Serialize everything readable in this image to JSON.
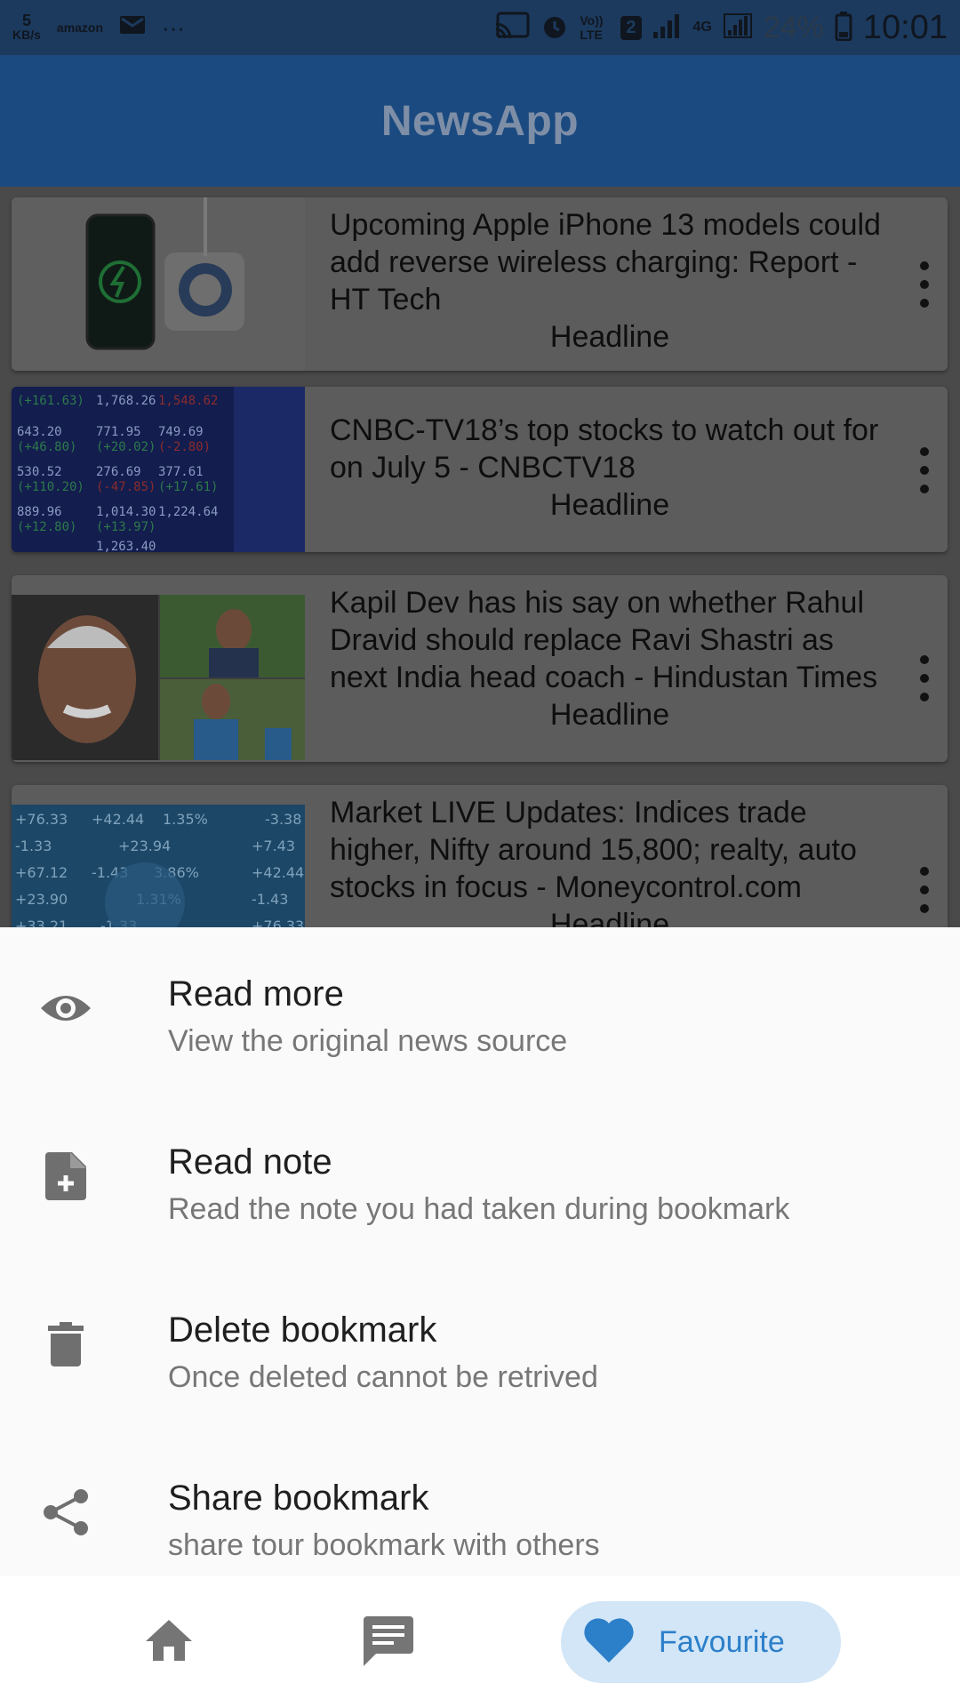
{
  "status_bar": {
    "net_speed_value": "5",
    "net_speed_unit": "KB/s",
    "notification_labels": [
      "amazon"
    ],
    "overflow": "···",
    "volte_label": "Vo)) LTE",
    "sim_badge": "2",
    "network_type": "4G",
    "battery_percent": "24%",
    "time": "10:01"
  },
  "app_bar": {
    "title": "NewsApp"
  },
  "articles": [
    {
      "title": "Upcoming Apple iPhone 13 models could add reverse wireless charging: Report - HT Tech",
      "category": "Headline",
      "thumb_icon": "iphone-charger-image"
    },
    {
      "title": "CNBC-TV18’s top stocks to watch out for on July 5 - CNBCTV18",
      "category": "Headline",
      "thumb_icon": "stock-board-image"
    },
    {
      "title": "Kapil Dev has his say on whether Rahul Dravid should replace Ravi Shastri as next India head coach - Hindustan Times",
      "category": "Headline",
      "thumb_icon": "cricketers-image"
    },
    {
      "title": "Market LIVE Updates: Indices trade higher, Nifty around 15,800; realty, auto stocks in focus - Moneycontrol.com",
      "category": "Headline",
      "thumb_icon": "market-image"
    }
  ],
  "sheet": {
    "items": [
      {
        "label": "Read more",
        "sub": "View the original news source",
        "icon": "eye-icon"
      },
      {
        "label": "Read note",
        "sub": "Read the note you had taken during bookmark",
        "icon": "note-add-icon"
      },
      {
        "label": "Delete bookmark",
        "sub": "Once deleted cannot be retrived",
        "icon": "trash-icon"
      },
      {
        "label": "Share bookmark",
        "sub": "share tour bookmark with others",
        "icon": "share-icon"
      }
    ]
  },
  "bottom_nav": {
    "items": [
      {
        "icon": "home-icon",
        "label": ""
      },
      {
        "icon": "chat-icon",
        "label": ""
      },
      {
        "icon": "heart-icon",
        "label": "Favourite",
        "active": true
      }
    ]
  },
  "colors": {
    "accent": "#2c7fc9",
    "active_pill": "#d2e6f7",
    "app_bar": "#1b4a80",
    "overlay_list": "#5c5c5c"
  }
}
